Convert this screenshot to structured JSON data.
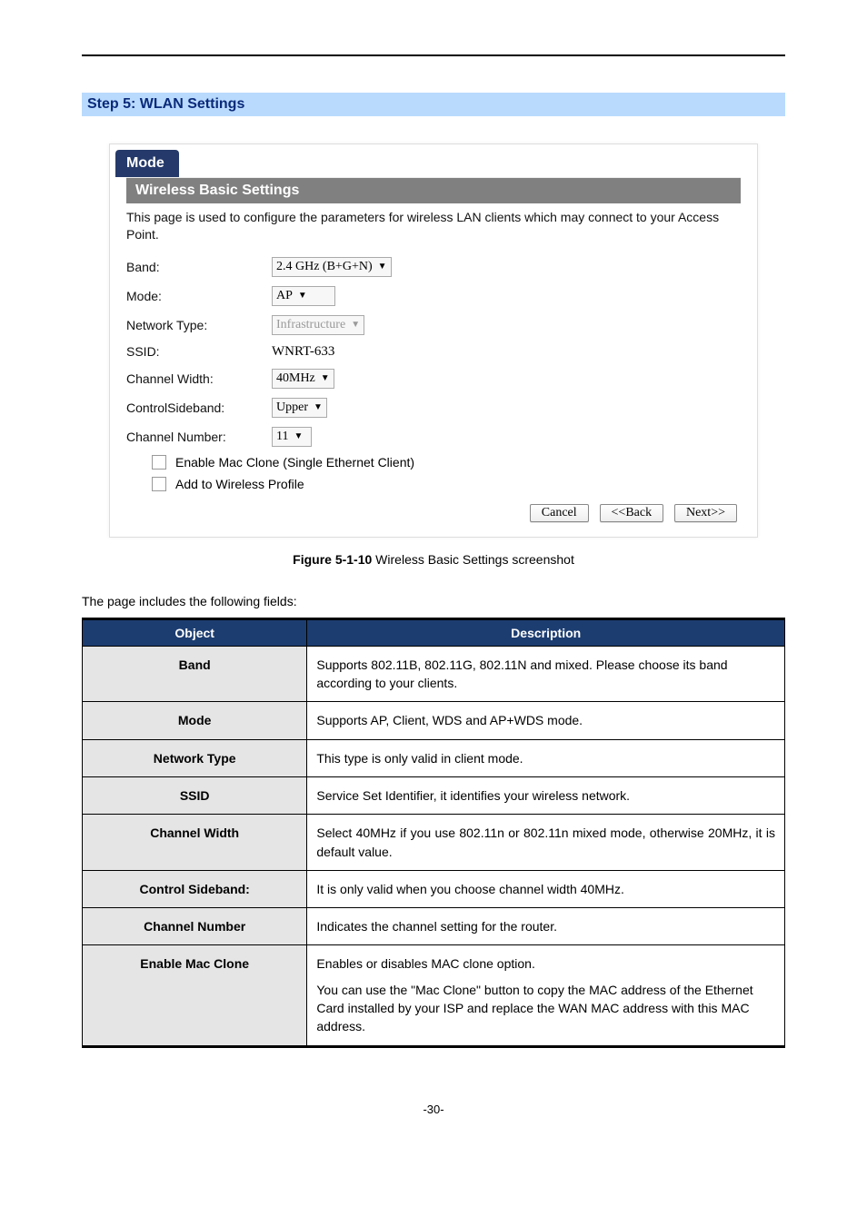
{
  "step_title": "Step 5: WLAN Settings",
  "screenshot": {
    "mode_tab": "Mode",
    "section_title": "Wireless  Basic Settings",
    "description": "This page is used to configure the parameters for wireless LAN clients which may connect to your Access Point.",
    "fields": {
      "band_label": "Band:",
      "band_value": "2.4 GHz (B+G+N)",
      "mode_label": "Mode:",
      "mode_value": "AP",
      "nettype_label": "Network Type:",
      "nettype_value": "Infrastructure",
      "ssid_label": "SSID:",
      "ssid_value": "WNRT-633",
      "chw_label": "Channel Width:",
      "chw_value": "40MHz",
      "csb_label": "ControlSideband:",
      "csb_value": "Upper",
      "chn_label": "Channel Number:",
      "chn_value": "11"
    },
    "checkboxes": {
      "mac_clone": "Enable Mac Clone (Single Ethernet Client)",
      "wprofile": "Add to Wireless Profile"
    },
    "buttons": {
      "cancel": "Cancel",
      "back": "<<Back",
      "next": "Next>>"
    }
  },
  "caption_prefix": "Figure 5-1-10",
  "caption_rest": " Wireless Basic Settings screenshot",
  "intro": "The page includes the following fields:",
  "table": {
    "head_obj": "Object",
    "head_desc": "Description",
    "rows": [
      {
        "k": "Band",
        "v": "Supports 802.11B, 802.11G, 802.11N and mixed. Please choose its band according to your clients."
      },
      {
        "k": "Mode",
        "v": "Supports AP, Client, WDS and AP+WDS mode."
      },
      {
        "k": "Network Type",
        "v": "This type is only valid in client mode."
      },
      {
        "k": "SSID",
        "v": "Service Set Identifier, it identifies your wireless network."
      },
      {
        "k": "Channel Width",
        "v": "Select 40MHz if you use 802.11n or 802.11n mixed mode, otherwise 20MHz, it is default value.",
        "justify": true
      },
      {
        "k": "Control Sideband:",
        "v": "It is only valid when you choose channel width 40MHz."
      },
      {
        "k": "Channel Number",
        "v": "Indicates the channel setting for the router."
      },
      {
        "k": "Enable Mac Clone",
        "v": "Enables or disables MAC clone option.\nYou can use the \"Mac Clone\" button to copy the MAC address of the Ethernet Card installed by your ISP and replace the WAN MAC address with this MAC address."
      }
    ]
  },
  "page_number": "-30-"
}
